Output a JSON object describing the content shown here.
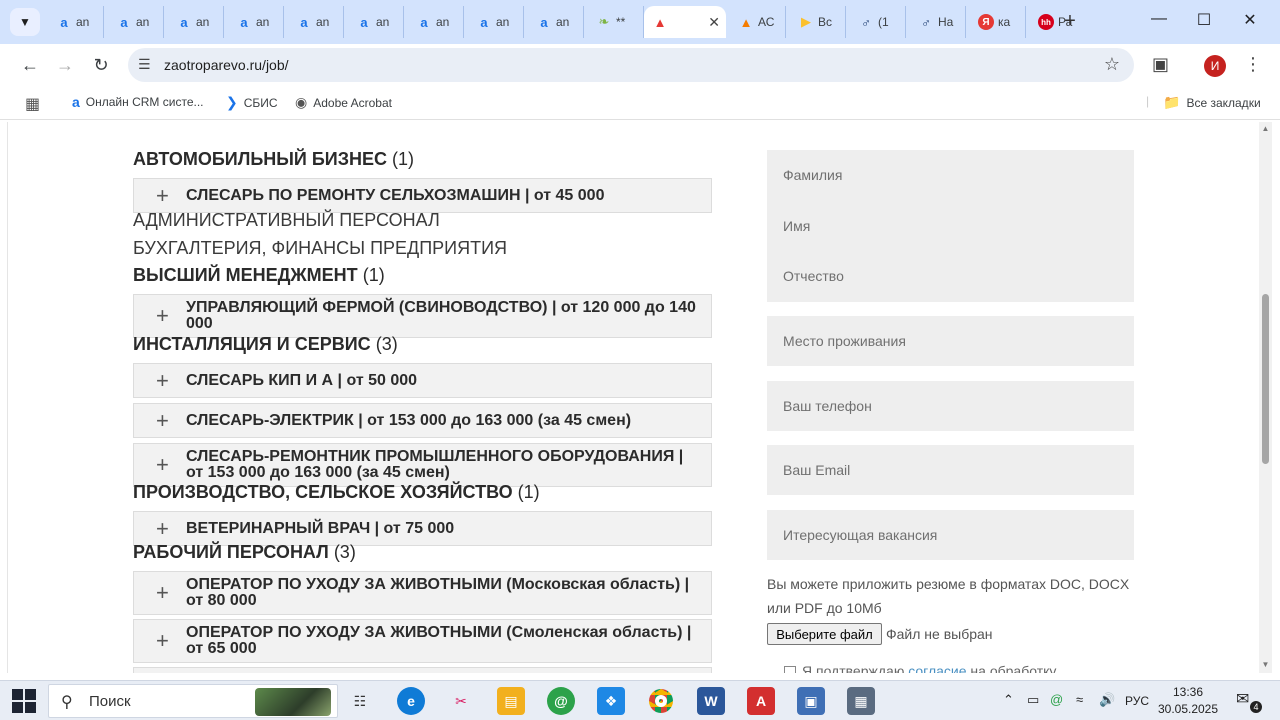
{
  "browser": {
    "tabs": [
      {
        "icon": "a",
        "label": "an",
        "color": "#1a73e8"
      },
      {
        "icon": "a",
        "label": "an",
        "color": "#1a73e8"
      },
      {
        "icon": "a",
        "label": "an",
        "color": "#1a73e8"
      },
      {
        "icon": "a",
        "label": "an",
        "color": "#1a73e8"
      },
      {
        "icon": "a",
        "label": "an",
        "color": "#1a73e8"
      },
      {
        "icon": "a",
        "label": "an",
        "color": "#1a73e8"
      },
      {
        "icon": "a",
        "label": "an",
        "color": "#1a73e8"
      },
      {
        "icon": "a",
        "label": "an",
        "color": "#1a73e8"
      },
      {
        "icon": "a",
        "label": "an",
        "color": "#1a73e8"
      },
      {
        "icon": "leaf",
        "label": "**",
        "color": "#7cb342"
      },
      {
        "icon": "hat",
        "label": "",
        "color": "#e53935",
        "active": true
      },
      {
        "icon": "flame",
        "label": "АС",
        "color": "#f57c00"
      },
      {
        "icon": "play",
        "label": "Вс",
        "color": "#fbc02d"
      },
      {
        "icon": "male",
        "label": "(1",
        "color": "#1a3a6e"
      },
      {
        "icon": "male",
        "label": "На",
        "color": "#1a3a6e"
      },
      {
        "icon": "Я",
        "label": "ка",
        "color": "#e53935"
      },
      {
        "icon": "hh",
        "label": "Ра",
        "color": "#d6001c"
      }
    ],
    "url": "zaotroparevo.ru/job/",
    "profile_initial": "И",
    "bookmarks": [
      {
        "label": "Онлайн CRM систе...",
        "icon": "a"
      },
      {
        "label": "СБИС",
        "icon": "sbis"
      },
      {
        "label": "Adobe Acrobat",
        "icon": "globe"
      }
    ],
    "all_bookmarks_label": "Все закладки"
  },
  "page": {
    "categories": [
      {
        "name": "АВТОМОБИЛЬНЫЙ БИЗНЕС",
        "count": "(1)"
      },
      {
        "name": "АДМИНИСТРАТИВНЫЙ ПЕРСОНАЛ",
        "count": ""
      },
      {
        "name": "БУХГАЛТЕРИЯ, ФИНАНСЫ ПРЕДПРИЯТИЯ",
        "count": ""
      },
      {
        "name": "ВЫСШИЙ МЕНЕДЖМЕНТ",
        "count": "(1)"
      },
      {
        "name": "ИНСТАЛЛЯЦИЯ И СЕРВИС",
        "count": "(3)"
      },
      {
        "name": "ПРОИЗВОДСТВО, СЕЛЬСКОЕ ХОЗЯЙСТВО",
        "count": "(1)"
      },
      {
        "name": "РАБОЧИЙ ПЕРСОНАЛ",
        "count": "(3)"
      }
    ],
    "jobs": [
      "СЛЕСАРЬ ПО РЕМОНТУ СЕЛЬХОЗМАШИН | от 45 000",
      "УПРАВЛЯЮЩИЙ ФЕРМОЙ (СВИНОВОДСТВО) | от 120 000 до 140 000",
      "СЛЕСАРЬ КИП И А | от 50 000",
      "СЛЕСАРЬ-ЭЛЕКТРИК | от 153 000 до 163 000 (за 45 смен)",
      "СЛЕСАРЬ-РЕМОНТНИК ПРОМЫШЛЕННОГО ОБОРУДОВАНИЯ | от 153 000 до 163 000 (за 45 смен)",
      "ВЕТЕРИНАРНЫЙ ВРАЧ | от 75 000",
      "ОПЕРАТОР ПО УХОДУ ЗА ЖИВОТНЫМИ (Московская область) | от 80 000",
      "ОПЕРАТОР ПО УХОДУ ЗА ЖИВОТНЫМИ (Смоленская область) | от 65 000"
    ],
    "form": {
      "lastname": "Фамилия",
      "firstname": "Имя",
      "patronymic": "Отчество",
      "residence": "Место проживания",
      "phone": "Ваш телефон",
      "email": "Ваш Email",
      "vacancy": "Итересующая вакансия",
      "file_hint": "Вы можете приложить резюме в форматах DOC, DOCX или PDF до 10Мб",
      "file_button": "Выберите файл",
      "file_status": "Файл не выбран",
      "consent_prefix": "Я подтверждаю",
      "consent_link": "согласие",
      "consent_suffix": "на обработку"
    }
  },
  "taskbar": {
    "search_label": "Поиск",
    "language": "РУС",
    "time": "13:36",
    "date": "30.05.2025",
    "notification_count": "4"
  },
  "colors": {
    "tabstrip": "#d3e3fd",
    "field_bg": "#eeeeee",
    "job_bg": "#f2f2f2",
    "link": "#4a90c2"
  }
}
